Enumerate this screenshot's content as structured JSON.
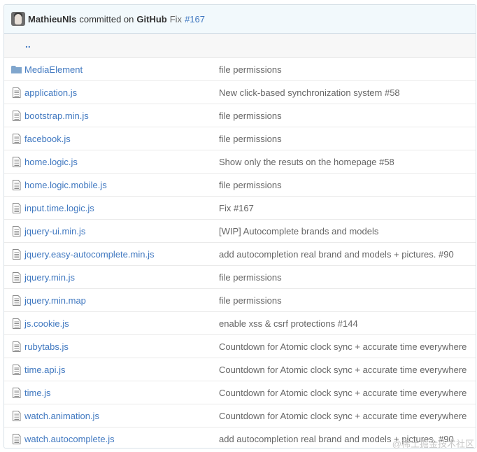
{
  "commit": {
    "author": "MathieuNls",
    "action": "committed on",
    "site": "GitHub",
    "message": "Fix",
    "ref": "#167"
  },
  "parent": {
    "label": ".."
  },
  "files": [
    {
      "name": "MediaElement",
      "type": "folder",
      "message": "file permissions"
    },
    {
      "name": "application.js",
      "type": "file",
      "message": "New click-based synchronization system #58"
    },
    {
      "name": "bootstrap.min.js",
      "type": "file",
      "message": "file permissions"
    },
    {
      "name": "facebook.js",
      "type": "file",
      "message": "file permissions"
    },
    {
      "name": "home.logic.js",
      "type": "file",
      "message": "Show only the resuts on the homepage #58"
    },
    {
      "name": "home.logic.mobile.js",
      "type": "file",
      "message": "file permissions"
    },
    {
      "name": "input.time.logic.js",
      "type": "file",
      "message": "Fix #167"
    },
    {
      "name": "jquery-ui.min.js",
      "type": "file",
      "message": "[WIP] Autocomplete brands and models"
    },
    {
      "name": "jquery.easy-autocomplete.min.js",
      "type": "file",
      "message": "add autocompletion real brand and models + pictures. #90"
    },
    {
      "name": "jquery.min.js",
      "type": "file",
      "message": "file permissions"
    },
    {
      "name": "jquery.min.map",
      "type": "file",
      "message": "file permissions"
    },
    {
      "name": "js.cookie.js",
      "type": "file",
      "message": "enable xss & csrf protections #144"
    },
    {
      "name": "rubytabs.js",
      "type": "file",
      "message": "Countdown for Atomic clock sync + accurate time everywhere"
    },
    {
      "name": "time.api.js",
      "type": "file",
      "message": "Countdown for Atomic clock sync + accurate time everywhere"
    },
    {
      "name": "time.js",
      "type": "file",
      "message": "Countdown for Atomic clock sync + accurate time everywhere"
    },
    {
      "name": "watch.animation.js",
      "type": "file",
      "message": "Countdown for Atomic clock sync + accurate time everywhere"
    },
    {
      "name": "watch.autocomplete.js",
      "type": "file",
      "message": "add autocompletion real brand and models + pictures. #90"
    }
  ],
  "watermark": "@稀土掘金技术社区",
  "colors": {
    "link": "#4078c0",
    "header_bg": "#f2f9fc",
    "folder_icon": "#80a6cd",
    "file_icon": "#999999"
  }
}
